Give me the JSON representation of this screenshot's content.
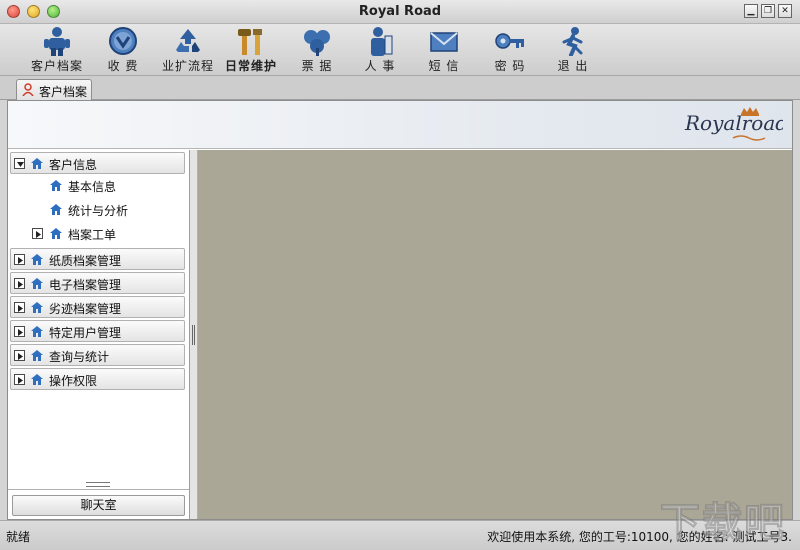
{
  "window": {
    "title": "Royal Road"
  },
  "toolbar": {
    "items": [
      {
        "label": "客户档案",
        "icon": "customer-file-icon"
      },
      {
        "label": "收 费",
        "icon": "charge-icon"
      },
      {
        "label": "业扩流程",
        "icon": "recycle-process-icon"
      },
      {
        "label": "日常维护",
        "icon": "tools-icon"
      },
      {
        "label": "票 据",
        "icon": "clover-receipt-icon"
      },
      {
        "label": "人 事",
        "icon": "personnel-icon"
      },
      {
        "label": "短 信",
        "icon": "envelope-icon"
      },
      {
        "label": "密 码",
        "icon": "key-icon"
      },
      {
        "label": "退 出",
        "icon": "exit-runner-icon"
      }
    ]
  },
  "tabs": {
    "active_label": "客户档案"
  },
  "brand": {
    "logo_text": "Royalroad"
  },
  "sidebar": {
    "groups": [
      {
        "label": "客户信息"
      },
      {
        "label": "纸质档案管理"
      },
      {
        "label": "电子档案管理"
      },
      {
        "label": "劣迹档案管理"
      },
      {
        "label": "特定用户管理"
      },
      {
        "label": "查询与统计"
      },
      {
        "label": "操作权限"
      }
    ],
    "children": [
      {
        "label": "基本信息"
      },
      {
        "label": "统计与分析"
      },
      {
        "label": "档案工单"
      }
    ],
    "chat_button": "聊天室"
  },
  "status": {
    "left": "就绪",
    "right": "欢迎使用本系统, 您的工号:10100, 您的姓名: 测试工号3."
  },
  "watermark": "下载吧",
  "colors": {
    "content_bg": "#aaa797",
    "icon_blue": "#2f5f9e",
    "accent_orange": "#c8742a"
  }
}
